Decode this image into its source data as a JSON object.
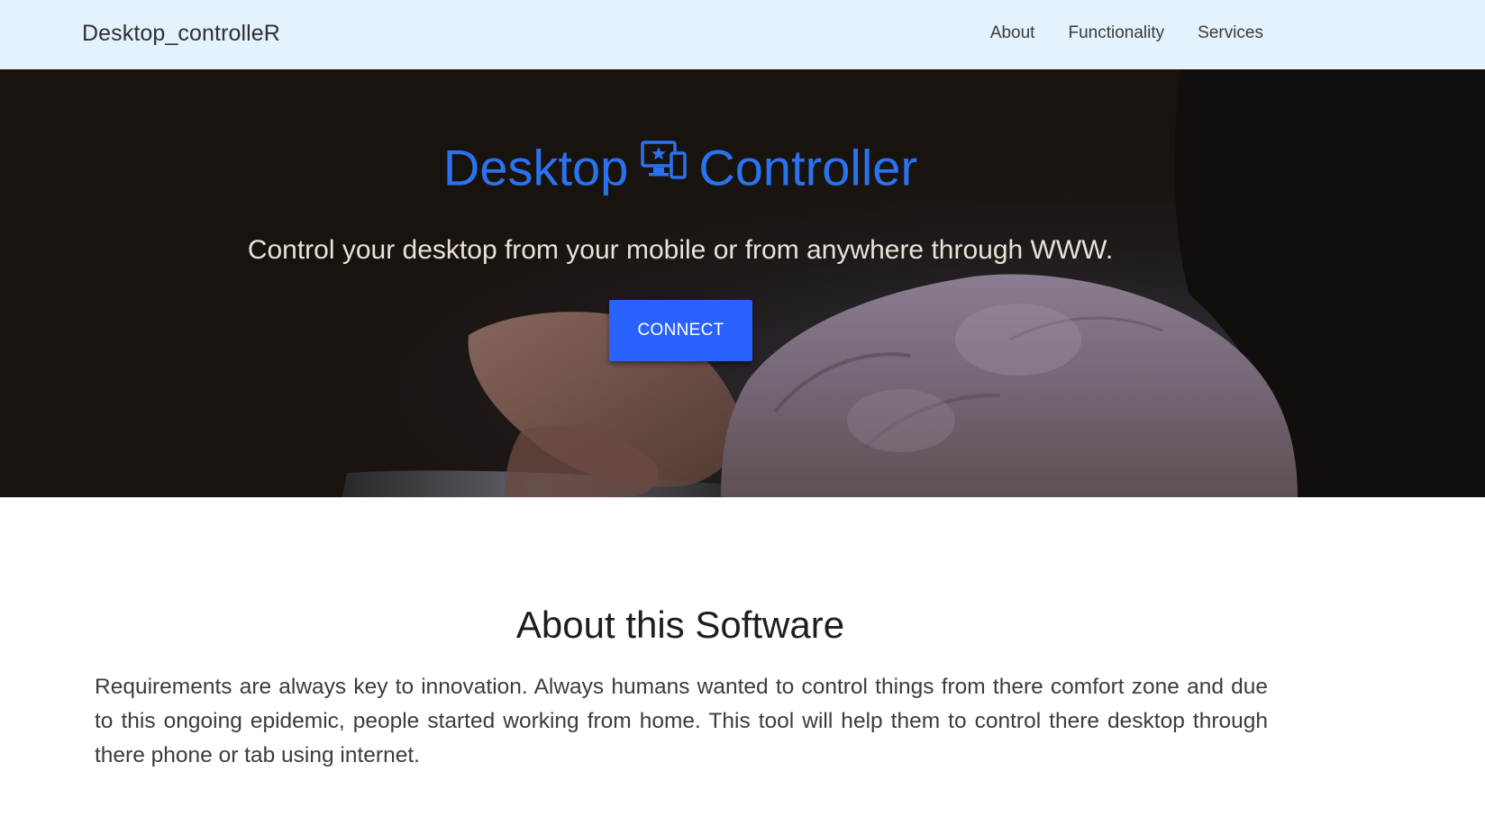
{
  "navbar": {
    "brand": "Desktop_controlleR",
    "links": [
      {
        "label": "About"
      },
      {
        "label": "Functionality"
      },
      {
        "label": "Services"
      }
    ],
    "background_color": "#e3f2fd"
  },
  "hero": {
    "title_left": "Desktop",
    "title_icon": "desktop-mobile-devices-icon",
    "title_right": "Controller",
    "subtitle": "Control your desktop from your mobile or from anywhere through WWW.",
    "button_label": "CONNECT",
    "background_image": "hands-holding-smartphone-photo",
    "title_color": "#2a73f0",
    "button_color": "#2962ff"
  },
  "about": {
    "title": "About this Software",
    "body": "Requirements are always key to innovation. Always humans wanted to control things from there comfort zone and due to this ongoing epidemic, people started working from home. This tool will help them to control there desktop through there phone or tab using internet."
  }
}
